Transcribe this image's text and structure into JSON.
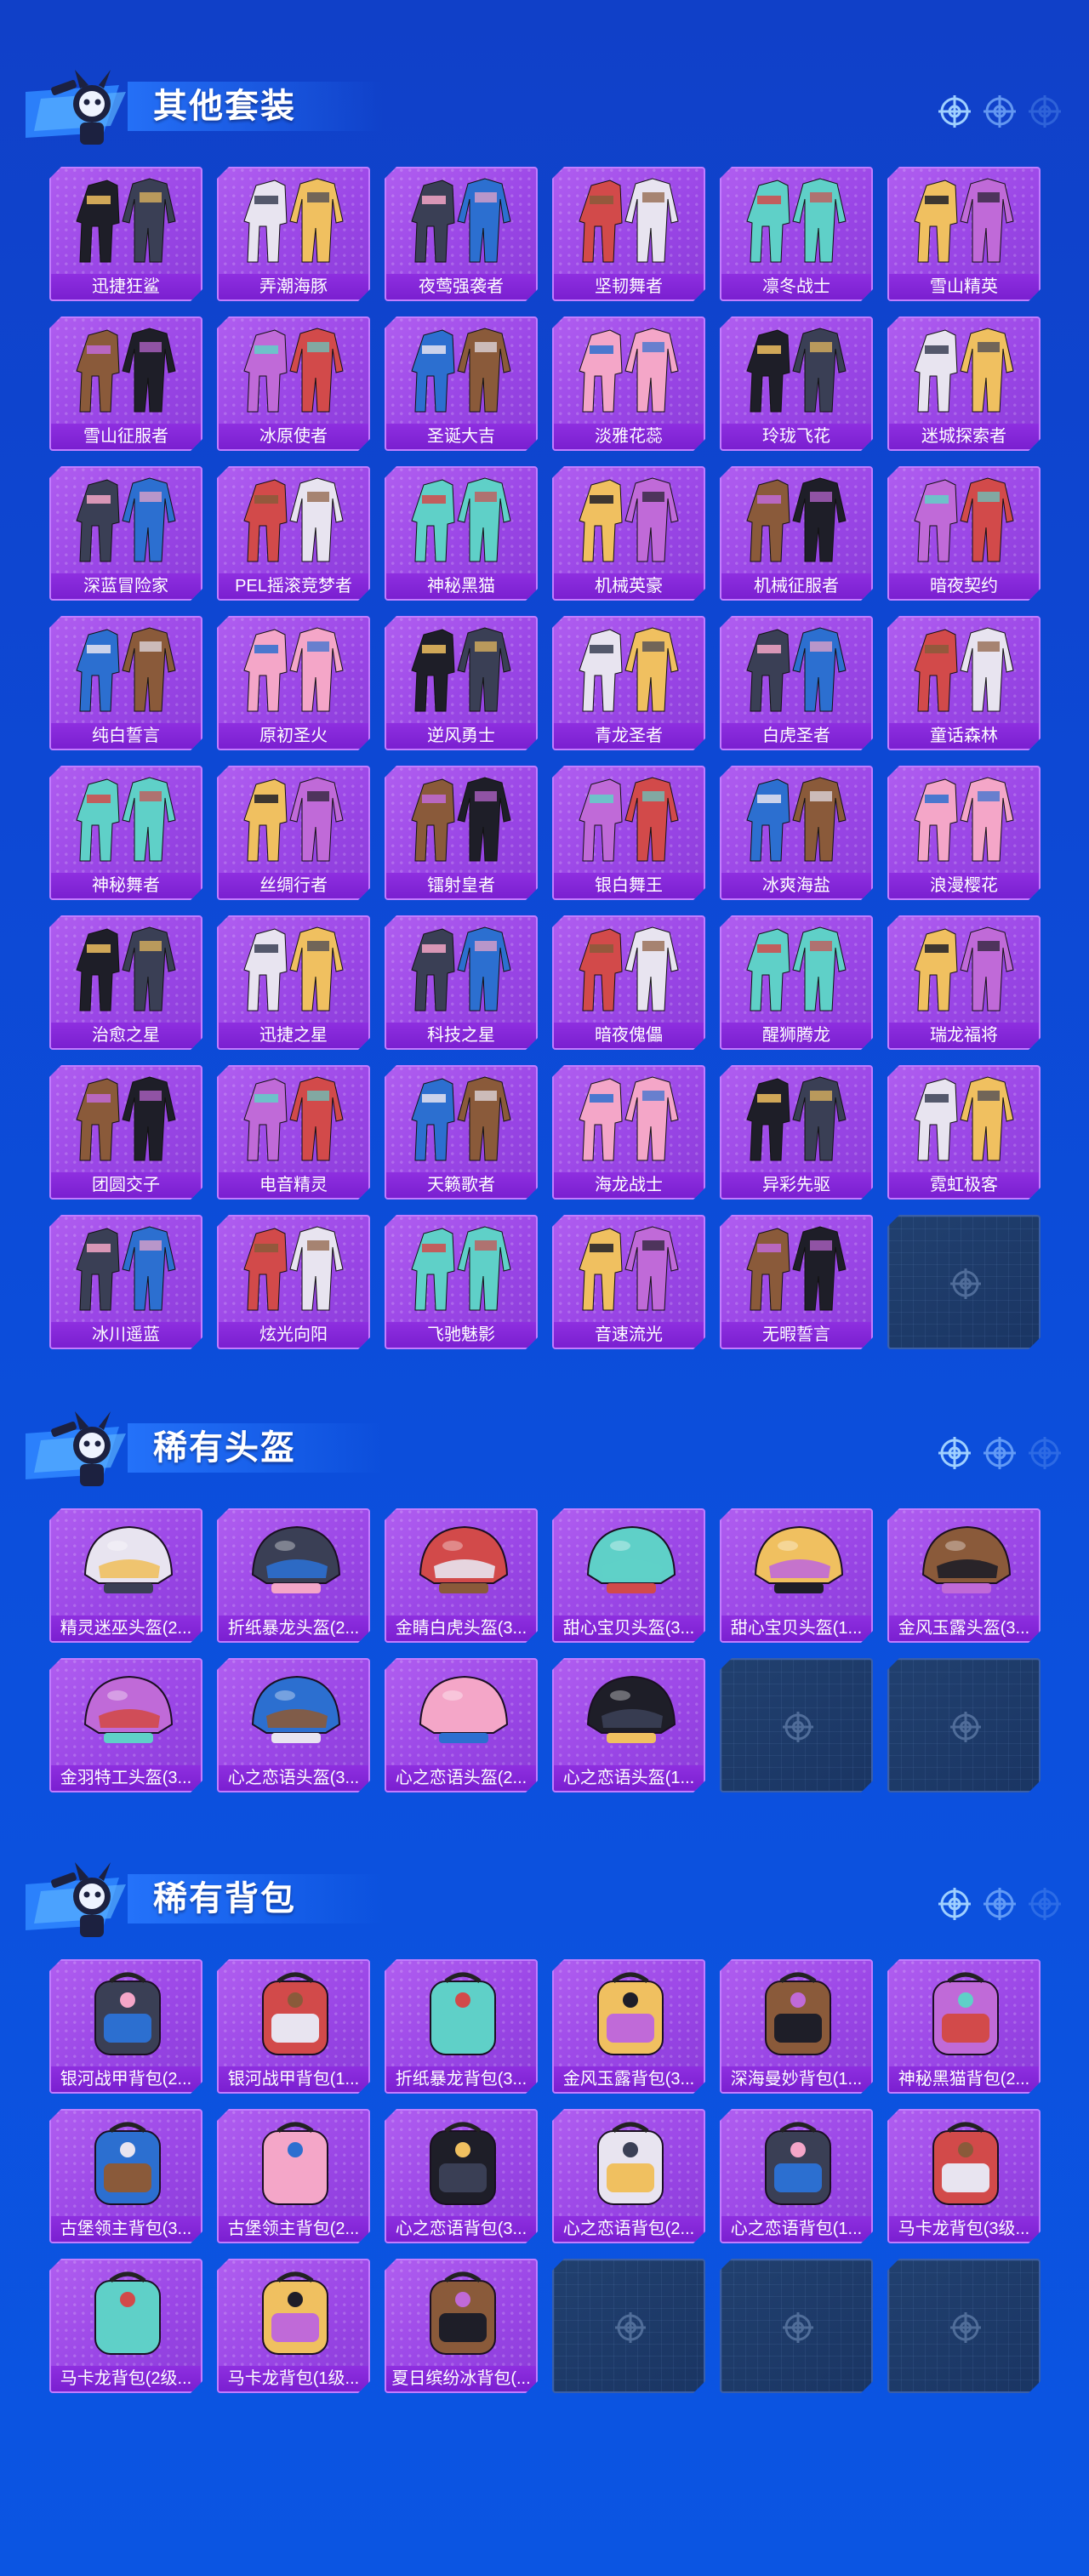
{
  "sections": [
    {
      "title": "其他套装",
      "kind": "suit",
      "items": [
        "迅捷狂鲨",
        "弄潮海豚",
        "夜莺强袭者",
        "坚韧舞者",
        "凛冬战士",
        "雪山精英",
        "雪山征服者",
        "冰原使者",
        "圣诞大吉",
        "淡雅花蕊",
        "玲珑飞花",
        "迷城探索者",
        "深蓝冒险家",
        "PEL摇滚竞梦者",
        "神秘黑猫",
        "机械英豪",
        "机械征服者",
        "暗夜契约",
        "纯白誓言",
        "原初圣火",
        "逆风勇士",
        "青龙圣者",
        "白虎圣者",
        "童话森林",
        "神秘舞者",
        "丝绸行者",
        "镭射皇者",
        "银白舞王",
        "冰爽海盐",
        "浪漫樱花",
        "治愈之星",
        "迅捷之星",
        "科技之星",
        "暗夜傀儡",
        "醒狮腾龙",
        "瑞龙福将",
        "团圆交子",
        "电音精灵",
        "天籁歌者",
        "海龙战士",
        "异彩先驱",
        "霓虹极客",
        "冰川遥蓝",
        "炫光向阳",
        "飞驰魅影",
        "音速流光",
        "无暇誓言"
      ],
      "empty_slots": 1
    },
    {
      "title": "稀有头盔",
      "kind": "helmet",
      "items": [
        "精灵迷巫头盔(2...",
        "折纸暴龙头盔(2...",
        "金睛白虎头盔(3...",
        "甜心宝贝头盔(3...",
        "甜心宝贝头盔(1...",
        "金风玉露头盔(3...",
        "金羽特工头盔(3...",
        "心之恋语头盔(3...",
        "心之恋语头盔(2...",
        "心之恋语头盔(1..."
      ],
      "empty_slots": 2
    },
    {
      "title": "稀有背包",
      "kind": "backpack",
      "items": [
        "银河战甲背包(2...",
        "银河战甲背包(1...",
        "折纸暴龙背包(3...",
        "金风玉露背包(3...",
        "深海曼妙背包(1...",
        "神秘黑猫背包(2...",
        "古堡领主背包(3...",
        "古堡领主背包(2...",
        "心之恋语背包(3...",
        "心之恋语背包(2...",
        "心之恋语背包(1...",
        "马卡龙背包(3级...",
        "马卡龙背包(2级...",
        "马卡龙背包(1级...",
        "夏日缤纷冰背包(..."
      ],
      "empty_slots": 3
    }
  ],
  "colors": {
    "background": "#0d48d4",
    "card_purple": "#a552ec",
    "card_border": "#c37cff",
    "label_bg": "#8226d6",
    "empty_card": "#1e3b6a"
  },
  "icons": [
    "mascot-icon",
    "target-crosshair-icon",
    "outfit-icon",
    "helmet-icon",
    "backpack-icon"
  ]
}
